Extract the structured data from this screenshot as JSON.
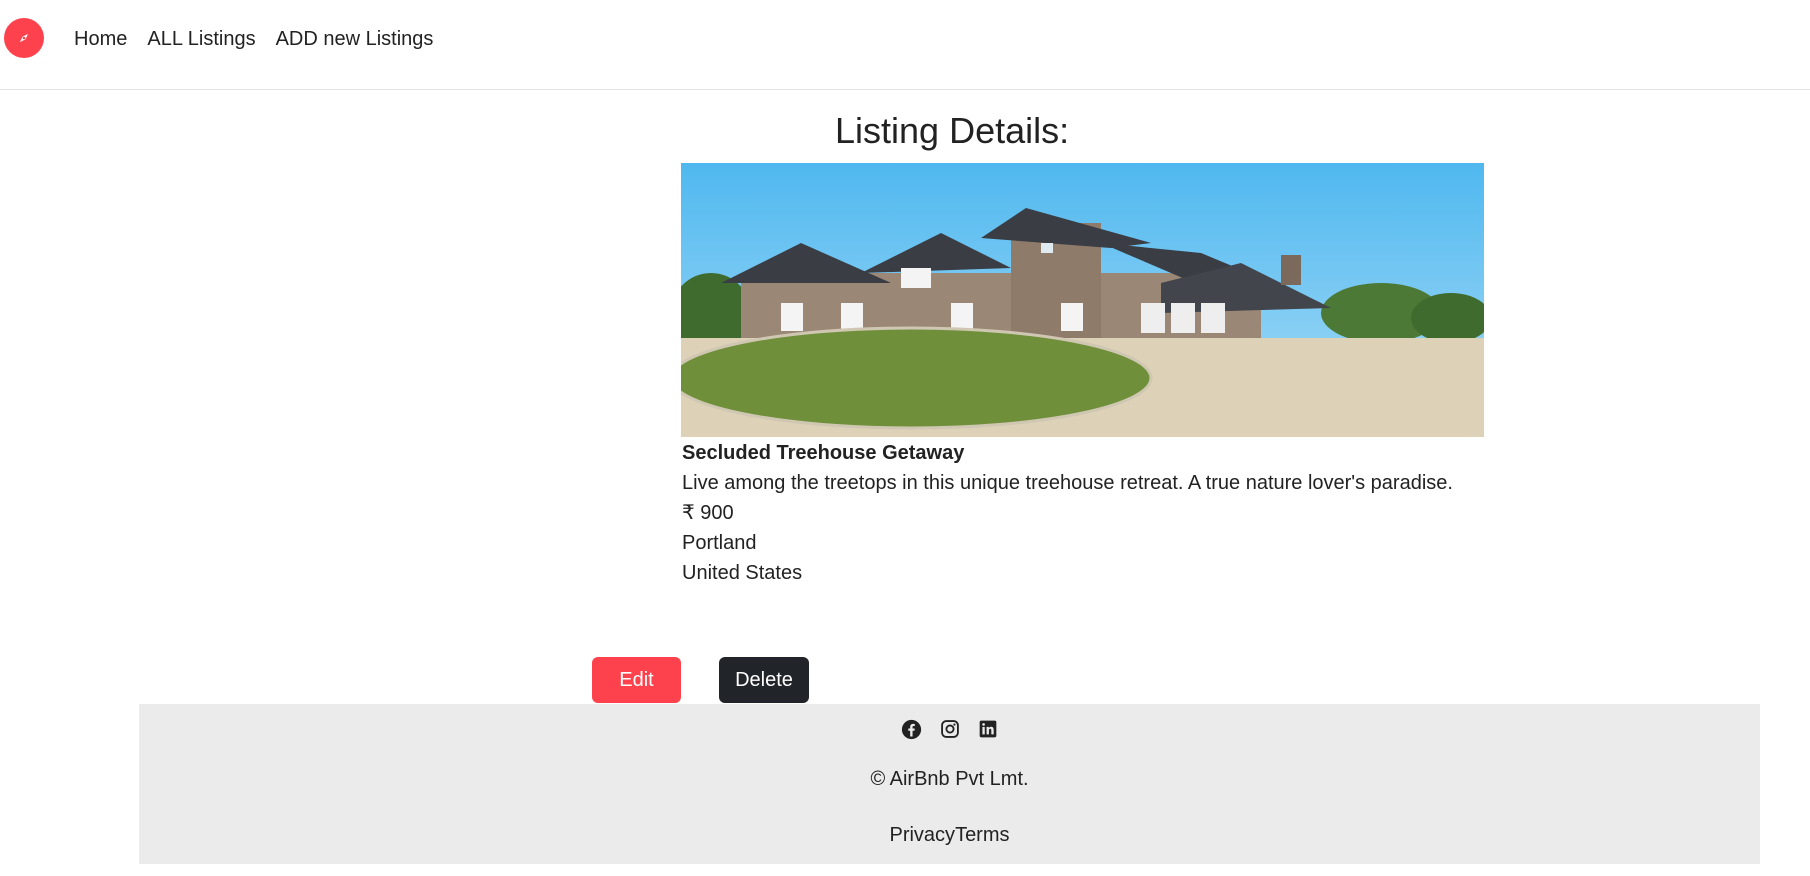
{
  "nav": {
    "logo_icon": "compass-icon",
    "links": [
      "Home",
      "ALL Listings",
      "ADD new Listings"
    ]
  },
  "main": {
    "title": "Listing Details:",
    "listing": {
      "name": "Secluded Treehouse Getaway",
      "description": "Live among the treetops in this unique treehouse retreat. A true nature lover's paradise.",
      "price": "₹ 900",
      "city": "Portland",
      "country": "United States"
    },
    "edit_label": "Edit",
    "delete_label": "Delete"
  },
  "footer": {
    "social_icons": [
      "facebook-icon",
      "instagram-icon",
      "linkedin-icon"
    ],
    "copyright": "© AirBnb Pvt Lmt.",
    "privacy_label": "Privacy",
    "terms_label": "Terms"
  },
  "colors": {
    "brand": "#fe424d",
    "dark": "#212529",
    "footer_bg": "#ebebeb"
  }
}
